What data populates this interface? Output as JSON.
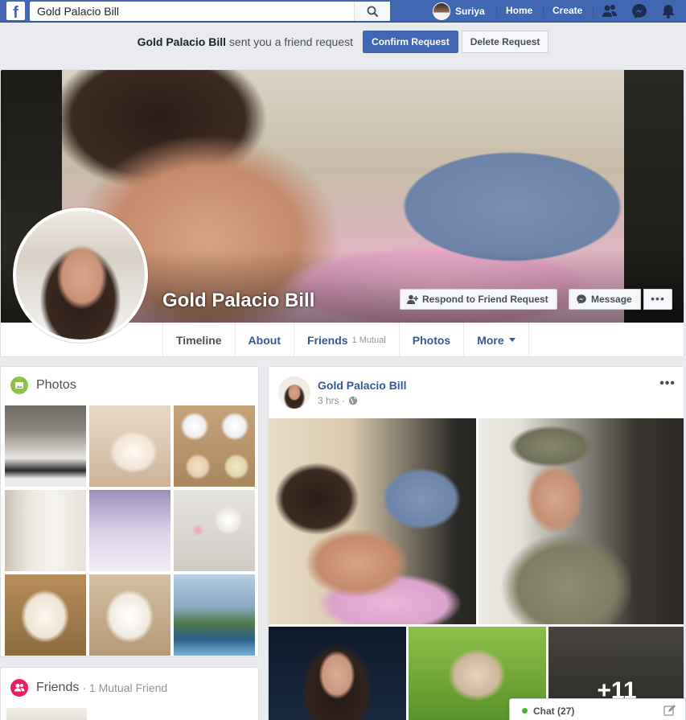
{
  "topbar": {
    "search_value": "Gold Palacio Bill",
    "user_name": "Suriya",
    "home_label": "Home",
    "create_label": "Create",
    "brand_color": "#4267b2"
  },
  "request": {
    "sender": "Gold Palacio Bill",
    "text": "sent you a friend request",
    "confirm_label": "Confirm Request",
    "delete_label": "Delete Request"
  },
  "profile": {
    "name": "Gold Palacio Bill",
    "respond_label": "Respond to Friend Request",
    "message_label": "Message",
    "more_label": "•••"
  },
  "tabs": [
    {
      "label": "Timeline",
      "sub": ""
    },
    {
      "label": "About",
      "sub": ""
    },
    {
      "label": "Friends",
      "sub": "1 Mutual"
    },
    {
      "label": "Photos",
      "sub": ""
    },
    {
      "label": "More",
      "sub": ""
    }
  ],
  "photos_card": {
    "title": "Photos",
    "icon_color": "#8bc34a"
  },
  "friends_card": {
    "title": "Friends",
    "sub": "· 1 Mutual Friend",
    "icon_color": "#e91e63"
  },
  "post": {
    "author": "Gold Palacio Bill",
    "time": "3 hrs ·",
    "menu_label": "•••",
    "more_count": "+11"
  },
  "chat": {
    "label": "Chat (27)",
    "status_color": "#42b72a"
  }
}
